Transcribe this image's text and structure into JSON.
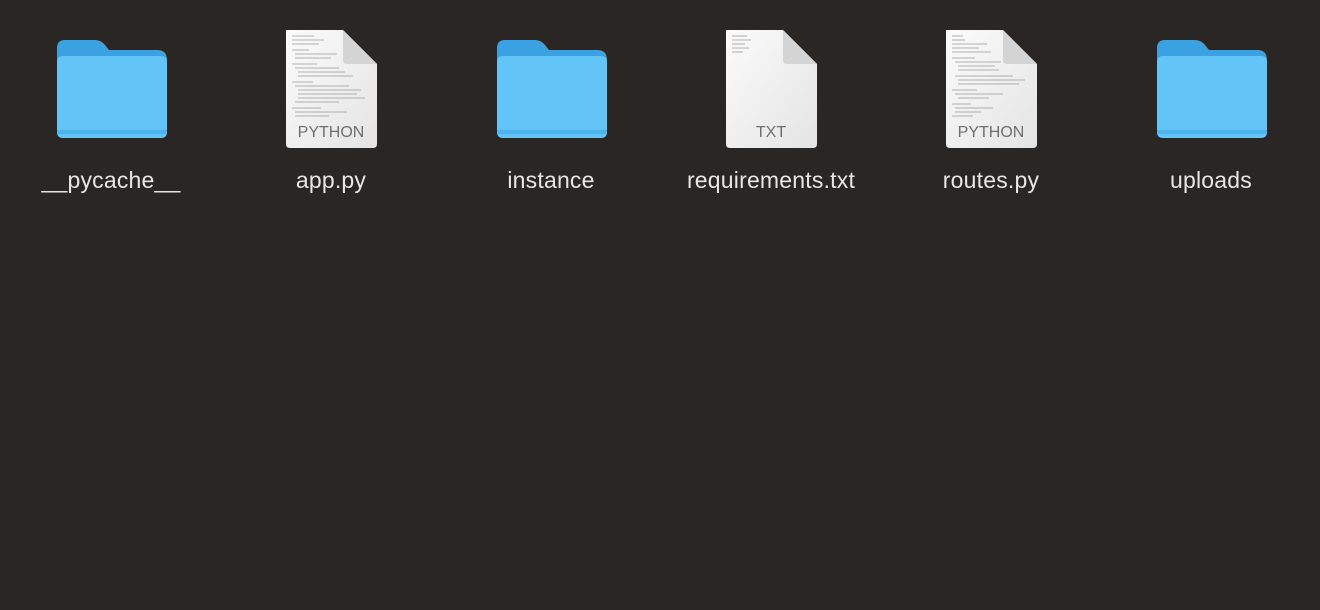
{
  "colors": {
    "background": "#2a2624",
    "folder_front": "#63c5f7",
    "folder_back": "#3aa2e3",
    "document": "#f1f1f1",
    "document_label": "#6f6f6f",
    "item_label": "#e9e6e3"
  },
  "items": [
    {
      "name": "__pycache__",
      "kind": "folder",
      "icon": "folder-icon"
    },
    {
      "name": "app.py",
      "kind": "document",
      "icon": "python-file-icon",
      "badge": "PYTHON"
    },
    {
      "name": "instance",
      "kind": "folder",
      "icon": "folder-icon"
    },
    {
      "name": "requirements.txt",
      "kind": "document",
      "icon": "text-file-icon",
      "badge": "TXT"
    },
    {
      "name": "routes.py",
      "kind": "document",
      "icon": "python-file-icon",
      "badge": "PYTHON"
    },
    {
      "name": "uploads",
      "kind": "folder",
      "icon": "folder-icon"
    }
  ]
}
